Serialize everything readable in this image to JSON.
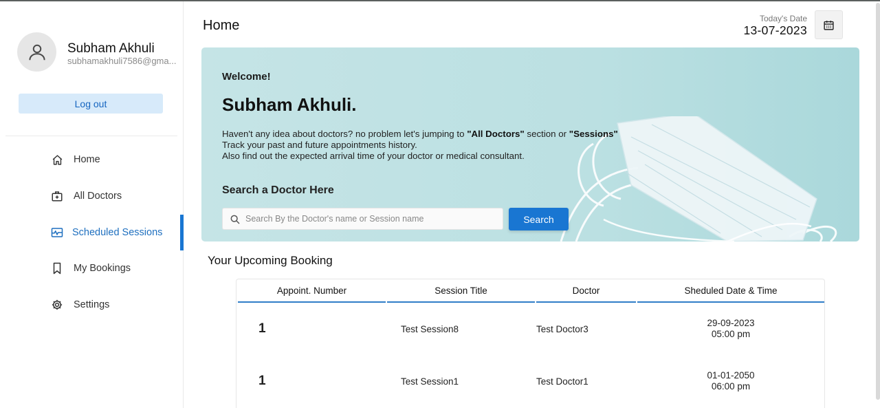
{
  "sidebar": {
    "profile": {
      "name": "Subham Akhuli",
      "email": "subhamakhuli7586@gma..."
    },
    "logout_label": "Log out",
    "nav": [
      {
        "label": "Home",
        "icon": "home-icon"
      },
      {
        "label": "All Doctors",
        "icon": "medical-kit-icon"
      },
      {
        "label": "Scheduled Sessions",
        "icon": "pulse-monitor-icon",
        "active": true
      },
      {
        "label": "My Bookings",
        "icon": "bookmark-icon"
      },
      {
        "label": "Settings",
        "icon": "gear-icon"
      }
    ]
  },
  "header": {
    "title": "Home",
    "date_label": "Today's Date",
    "date_value": "13-07-2023",
    "calendar_icon": "calendar-icon"
  },
  "banner": {
    "welcome": "Welcome!",
    "name": "Subham Akhuli.",
    "line1_part1": "Haven't any idea about doctors? no problem let's jumping to ",
    "line1_bold1": "\"All Doctors\"",
    "line1_part2": " section or ",
    "line1_bold2": "\"Sessions\"",
    "line2": "Track your past and future appointments history.",
    "line3": "Also find out the expected arrival time of your doctor or medical consultant.",
    "search_heading": "Search a Doctor Here",
    "search_placeholder": "Search By the Doctor's name or Session name",
    "search_button": "Search"
  },
  "upcoming": {
    "title": "Your Upcoming Booking",
    "columns": [
      "Appoint. Number",
      "Session Title",
      "Doctor",
      "Sheduled Date & Time"
    ],
    "rows": [
      {
        "number": "1",
        "session": "Test Session8",
        "doctor": "Test Doctor3",
        "date": "29-09-2023",
        "time": "05:00 pm"
      },
      {
        "number": "1",
        "session": "Test Session1",
        "doctor": "Test Doctor1",
        "date": "01-01-2050",
        "time": "06:00 pm"
      }
    ]
  },
  "colors": {
    "accent": "#1976d2",
    "logout_bg": "#d7eafa",
    "banner_bg": "#bbe0e2"
  }
}
